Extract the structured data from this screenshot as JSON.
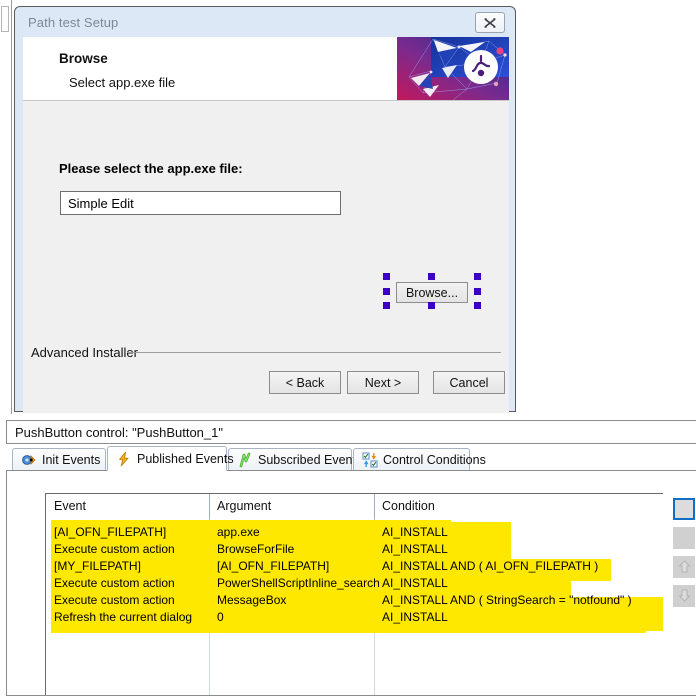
{
  "dialog": {
    "title": "Path test Setup",
    "close_icon": "close-icon",
    "header_title": "Browse",
    "header_subtitle": "Select app.exe file",
    "banner_icon": "advanced-installer-banner-graphic",
    "prompt": "Please select the app.exe file:",
    "path_value": "Simple Edit",
    "path_placeholder": "Simple Edit",
    "browse_label": "Browse...",
    "brand": "Advanced Installer",
    "buttons": {
      "back": "< Back",
      "next": "Next >",
      "cancel": "Cancel"
    }
  },
  "panel": {
    "caption": "PushButton control: \"PushButton_1\"",
    "tabs": [
      {
        "label": "Init Events",
        "icon": "init-events-icon",
        "active": false
      },
      {
        "label": "Published Events",
        "icon": "lightning-bolt-icon",
        "active": true
      },
      {
        "label": "Subscribed Events",
        "icon": "green-zigzag-icon",
        "active": false
      },
      {
        "label": "Control Conditions",
        "icon": "checkbox-arrows-icon",
        "active": false
      }
    ],
    "side_buttons": [
      {
        "name": "new-event-button",
        "icon": "blank-icon",
        "state": "focused"
      },
      {
        "name": "delete-event-button",
        "icon": "blank-icon",
        "state": "normal"
      },
      {
        "name": "move-up-button",
        "icon": "arrow-up-icon",
        "state": "disabled"
      },
      {
        "name": "move-down-button",
        "icon": "arrow-down-icon",
        "state": "disabled"
      }
    ]
  },
  "grid": {
    "columns": [
      "Event",
      "Argument",
      "Condition"
    ],
    "rows": [
      {
        "event": "[AI_OFN_FILEPATH]",
        "argument": "app.exe",
        "condition": "AI_INSTALL"
      },
      {
        "event": "Execute custom action",
        "argument": "BrowseForFile",
        "condition": "AI_INSTALL"
      },
      {
        "event": "[MY_FILEPATH]",
        "argument": "[AI_OFN_FILEPATH]",
        "condition": "AI_INSTALL AND ( AI_OFN_FILEPATH )"
      },
      {
        "event": "Execute custom action",
        "argument": "PowerShellScriptInline_search",
        "condition": "AI_INSTALL"
      },
      {
        "event": "Execute custom action",
        "argument": "MessageBox",
        "condition": "AI_INSTALL AND ( StringSearch = \"notfound\" )"
      },
      {
        "event": "Refresh the current dialog",
        "argument": "0",
        "condition": "AI_INSTALL"
      }
    ]
  },
  "colors": {
    "highlight": "#ffe800",
    "selection_handle": "#3b00c4",
    "focus_border": "#0e6fc4",
    "dialog_frame": "#dce8f5"
  }
}
